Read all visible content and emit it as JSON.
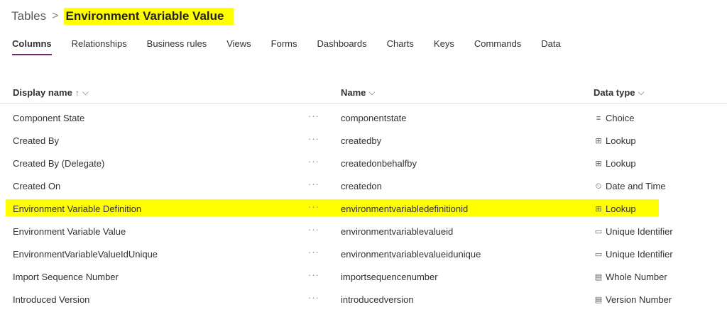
{
  "breadcrumb": {
    "parent": "Tables",
    "separator": ">",
    "current": "Environment Variable Value"
  },
  "tabs": [
    {
      "label": "Columns",
      "active": true
    },
    {
      "label": "Relationships"
    },
    {
      "label": "Business rules"
    },
    {
      "label": "Views"
    },
    {
      "label": "Forms"
    },
    {
      "label": "Dashboards"
    },
    {
      "label": "Charts"
    },
    {
      "label": "Keys"
    },
    {
      "label": "Commands"
    },
    {
      "label": "Data"
    }
  ],
  "table": {
    "headers": {
      "display_name": "Display name",
      "display_name_sort": "↑",
      "name": "Name",
      "data_type": "Data type",
      "chevron": "⌵"
    },
    "more_glyph": "···",
    "rows": [
      {
        "display_name": "Component State",
        "name": "componentstate",
        "type": "Choice",
        "icon": "choice-icon",
        "glyph": "≡"
      },
      {
        "display_name": "Created By",
        "name": "createdby",
        "type": "Lookup",
        "icon": "lookup-icon",
        "glyph": "⊞"
      },
      {
        "display_name": "Created By (Delegate)",
        "name": "createdonbehalfby",
        "type": "Lookup",
        "icon": "lookup-icon",
        "glyph": "⊞"
      },
      {
        "display_name": "Created On",
        "name": "createdon",
        "type": "Date and Time",
        "icon": "calendar-clock-icon",
        "glyph": "⏲"
      },
      {
        "display_name": "Environment Variable Definition",
        "name": "environmentvariabledefinitionid",
        "type": "Lookup",
        "icon": "lookup-icon",
        "glyph": "⊞",
        "highlight": true
      },
      {
        "display_name": "Environment Variable Value",
        "name": "environmentvariablevalueid",
        "type": "Unique Identifier",
        "icon": "unique-identifier-icon",
        "glyph": "▭"
      },
      {
        "display_name": "EnvironmentVariableValueIdUnique",
        "name": "environmentvariablevalueidunique",
        "type": "Unique Identifier",
        "icon": "unique-identifier-icon",
        "glyph": "▭"
      },
      {
        "display_name": "Import Sequence Number",
        "name": "importsequencenumber",
        "type": "Whole Number",
        "icon": "whole-number-icon",
        "glyph": "▤"
      },
      {
        "display_name": "Introduced Version",
        "name": "introducedversion",
        "type": "Version Number",
        "icon": "version-number-icon",
        "glyph": "▤"
      }
    ]
  }
}
